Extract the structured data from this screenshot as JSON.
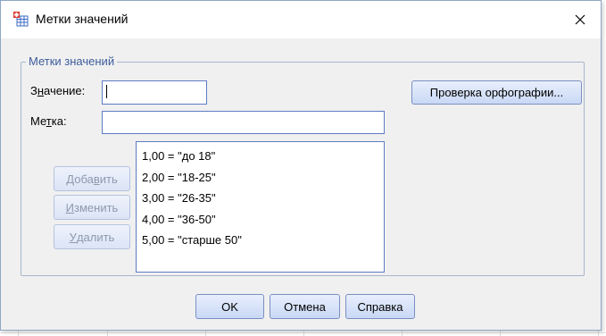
{
  "window": {
    "title": "Метки значений",
    "colors": {
      "accent": "#3c5c9c",
      "button": "#c9d8f5",
      "border": "#5e7cc4"
    }
  },
  "group": {
    "legend": "Метки значений",
    "value_label": {
      "pre": "З",
      "u": "н",
      "post": "ачение:"
    },
    "value_input": "",
    "label_label": {
      "pre": "Ме",
      "u": "т",
      "post": "ка:"
    },
    "label_input": "",
    "spellcheck_button": "Проверка орфографии...",
    "add_button": {
      "pre": "Доба",
      "u": "в",
      "post": "ить"
    },
    "change_button": {
      "pre": "",
      "u": "И",
      "post": "зменить"
    },
    "remove_button": {
      "pre": "",
      "u": "У",
      "post": "далить"
    },
    "list": [
      "1,00 = \"до 18\"",
      "2,00 = \"18-25\"",
      "3,00 = \"26-35\"",
      "4,00 = \"36-50\"",
      "5,00 = \"старше 50\""
    ]
  },
  "footer": {
    "ok": "OK",
    "cancel": "Отмена",
    "help": "Справка"
  }
}
